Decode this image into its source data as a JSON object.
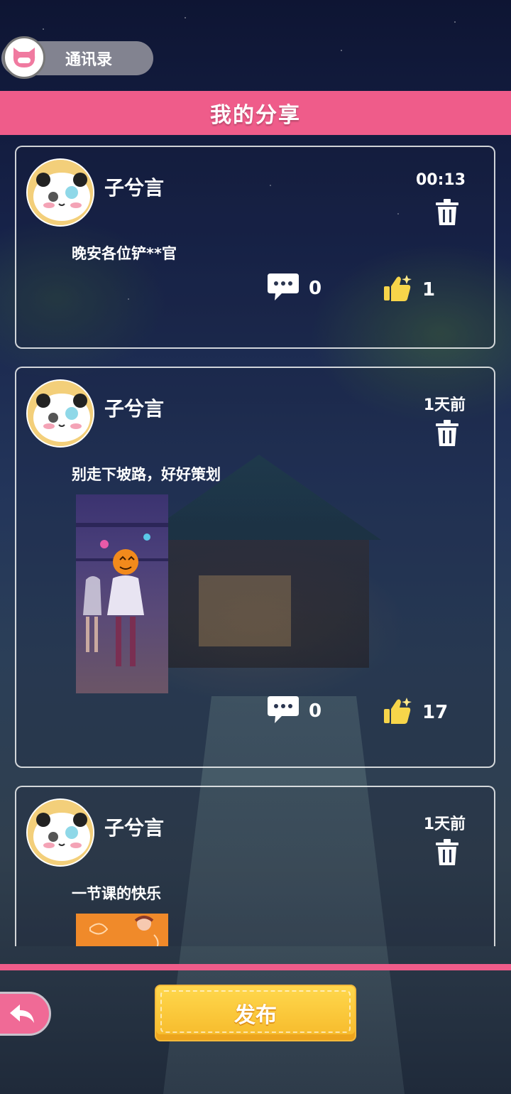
{
  "top": {
    "contacts_label": "通讯录"
  },
  "header": {
    "title": "我的分享"
  },
  "posts": [
    {
      "author": "子兮言",
      "time": "00:13",
      "text": "晚安各位铲**官",
      "comments": "0",
      "likes": "1",
      "has_image": false
    },
    {
      "author": "子兮言",
      "time": "1天前",
      "text": "别走下坡路，好好策划",
      "comments": "0",
      "likes": "17",
      "has_image": true
    },
    {
      "author": "子兮言",
      "time": "1天前",
      "text": "一节课的快乐",
      "has_image": true
    }
  ],
  "footer": {
    "publish_label": "发布"
  },
  "colors": {
    "accent_pink": "#ef5c8a",
    "publish_yellow": "#ffd84d"
  },
  "icons": [
    "cat-avatar-icon",
    "trash-icon",
    "comment-icon",
    "thumbs-up-icon",
    "back-arrow-icon"
  ]
}
